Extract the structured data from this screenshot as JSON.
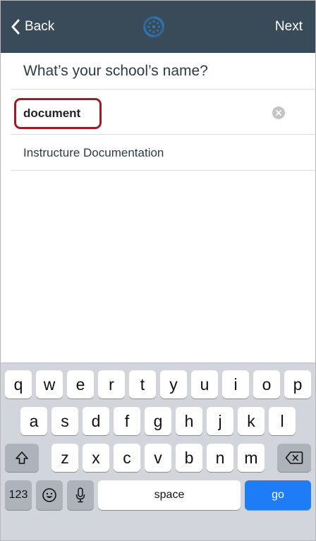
{
  "nav": {
    "back_label": "Back",
    "next_label": "Next",
    "logo_icon": "canvas-logo-icon"
  },
  "page": {
    "title": "What’s your school’s name?"
  },
  "search": {
    "value": "document",
    "clear_icon": "clear-circle-icon"
  },
  "results": [
    {
      "label": "Instructure Documentation"
    }
  ],
  "keyboard": {
    "row1": [
      "q",
      "w",
      "e",
      "r",
      "t",
      "y",
      "u",
      "i",
      "o",
      "p"
    ],
    "row2": [
      "a",
      "s",
      "d",
      "f",
      "g",
      "h",
      "j",
      "k",
      "l"
    ],
    "row3": [
      "z",
      "x",
      "c",
      "v",
      "b",
      "n",
      "m"
    ],
    "numbers_label": "123",
    "space_label": "space",
    "go_label": "go",
    "shift_icon": "shift-icon",
    "delete_icon": "backspace-icon",
    "emoji_icon": "emoji-icon",
    "mic_icon": "microphone-icon"
  },
  "colors": {
    "nav_bar": "#394b58",
    "logo": "#2b7abc",
    "highlight_outline": "#9b1c26",
    "go_key": "#1e7cf6",
    "keyboard_bg": "#d2d5db"
  }
}
